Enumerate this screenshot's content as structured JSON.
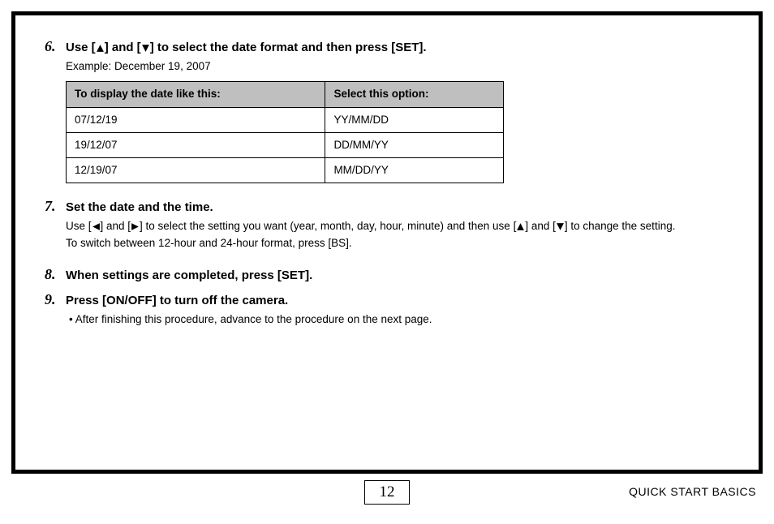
{
  "steps": {
    "s6": {
      "num": "6.",
      "title_a": "Use [",
      "title_b": "] and [",
      "title_c": "] to select the date format and then press [SET].",
      "example": "Example: December 19, 2007",
      "table": {
        "h1": "To display the date like this:",
        "h2": "Select this option:",
        "rows": [
          {
            "c1": "07/12/19",
            "c2": "YY/MM/DD"
          },
          {
            "c1": "19/12/07",
            "c2": "DD/MM/YY"
          },
          {
            "c1": "12/19/07",
            "c2": "MM/DD/YY"
          }
        ]
      }
    },
    "s7": {
      "num": "7.",
      "title": "Set the date and the time.",
      "body_a": "Use [",
      "body_b": "] and [",
      "body_c": "] to select the setting you want (year, month, day, hour, minute) and then use [",
      "body_d": "] and [",
      "body_e": "] to change the setting.",
      "body2": "To switch between 12-hour and 24-hour format, press [BS]."
    },
    "s8": {
      "num": "8.",
      "title": "When settings are completed, press [SET]."
    },
    "s9": {
      "num": "9.",
      "title": "Press [ON/OFF] to turn off the camera.",
      "bullet": "After finishing this procedure, advance to the procedure on the next page."
    }
  },
  "footer": {
    "page": "12",
    "section": "QUICK START BASICS"
  }
}
